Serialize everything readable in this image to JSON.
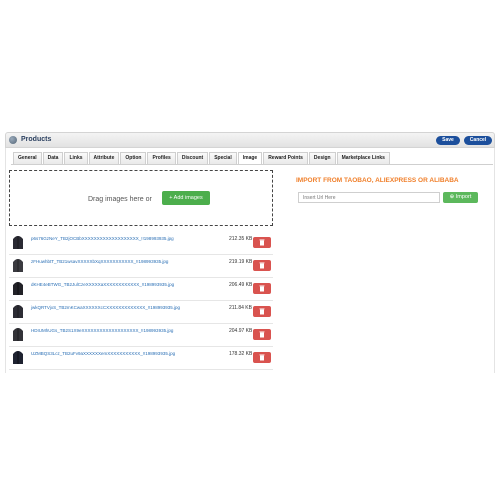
{
  "header": {
    "title": "Products",
    "save_label": "Save",
    "cancel_label": "Cancel"
  },
  "tabs": [
    "General",
    "Data",
    "Links",
    "Attribute",
    "Option",
    "Profiles",
    "Discount",
    "Special",
    "Image",
    "Reward Points",
    "Design",
    "Marketplace Links"
  ],
  "active_tab": "Image",
  "dropzone": {
    "text": "Drag images here or",
    "add_label": "+ Add images"
  },
  "images": [
    {
      "name": "p6s76GzNeY_TB2jOCBbXXXXXXXXXXXXXXXXXXX_!!198993935.jpg",
      "size": "212.35 KB"
    },
    {
      "name": "zFHuwhbtT_TB21wsavXXXXXbXqXXXXXXXXXXX_!!198993935.jpg",
      "size": "219.19 KB"
    },
    {
      "name": "dKHE4eBTWG_TB2JulCzeXXXXXaXXXXXXXXXXXX_!!198993935.jpg",
      "size": "206.49 KB"
    },
    {
      "name": "jwkQRTVjxS_TB2mKCwaXXXXXXcCXXXXXXXXXXXXX_!!198993935.jpg",
      "size": "211.84 KB"
    },
    {
      "name": "HDIUMhUGs_TB2S1X9eXXXXXXXXXXXXXXXXXXX_!!198993935.jpg",
      "size": "204.97 KB"
    },
    {
      "name": "UZMBQS3Lcz_TB2uFv9aXXXXXXemXXXXXXXXXXX_!!198993935.jpg",
      "size": "178.32 KB"
    }
  ],
  "import": {
    "title": "IMPORT FROM TAOBAO, ALIEXPRESS OR ALIBABA",
    "placeholder": "Insert Url Here",
    "button_label": "Import",
    "button_icon": "plus-circle-icon"
  },
  "colors": {
    "primary": "#1c4f9c",
    "success": "#4cae4c",
    "danger": "#d9534f",
    "accent": "#f07f2a",
    "link": "#2a6fb5"
  }
}
